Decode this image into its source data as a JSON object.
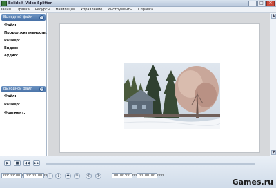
{
  "window": {
    "title": "Bolide® Video Splitter",
    "minimize": "–",
    "maximize": "□",
    "close": "✕"
  },
  "menu": [
    "Файл",
    "Правка",
    "Ресурсы",
    "Навигация",
    "Управление",
    "Инструменты",
    "Справка"
  ],
  "left_panel": {
    "input_header": "Выходной файл",
    "input_fields": [
      "Файл:",
      "Продолжительность:",
      "Размер:",
      "Видео:",
      "Аудио:"
    ],
    "output_header": "Выходной файл",
    "output_fields": [
      "Файл:",
      "Размер:",
      "Фрагмент:"
    ]
  },
  "scroll": {
    "up": "▲",
    "down": "▼"
  },
  "controls": {
    "play": "▶",
    "stop": "■",
    "prev": "◀◀",
    "next": "▶▶",
    "time_start": "00:00:00.000",
    "time_end": "00:00:00.000",
    "time_a": "00:00:00.000",
    "time_b": "00:00:00.000",
    "btn_a": "[",
    "btn_b": "]",
    "btn_c": "◆",
    "btn_d": "✂",
    "btn_e": "◐",
    "btn_f": "◑"
  },
  "watermark": "Games.ru",
  "colors": {
    "panel_header": "#4f78ad",
    "canvas_bg": "#ffffff",
    "workspace_bg": "#d6d8db"
  },
  "icons": {
    "app": "app-icon",
    "volume": "speaker-icon",
    "panel_toggle": "collapse-icon"
  }
}
